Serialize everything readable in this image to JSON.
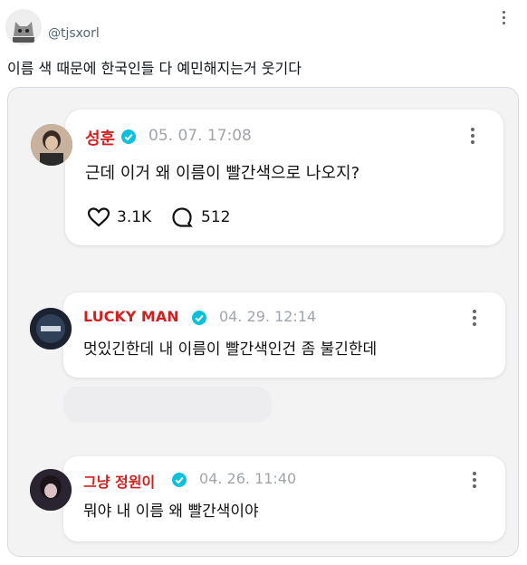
{
  "post": {
    "handle": "@tjsxorl",
    "text": "이름 색 때문에 한국인들 다 예민해지는거 웃기다",
    "avatar_icon": "cat-avatar-icon",
    "more_icon": "more-options-icon"
  },
  "colors": {
    "username_red": "#d31f1f",
    "verified_teal": "#0bc1d9",
    "date_gray": "#a0a5aa",
    "media_bg": "#f3f3f4"
  },
  "comments": [
    {
      "username": "성훈",
      "date": "05. 07. 17:08",
      "text": "근데 이거 왜 이름이 빨간색으로 나오지?",
      "likes": "3.1K",
      "replies": "512"
    },
    {
      "username": "LUCKY MAN",
      "date": "04. 29. 12:14",
      "text": "멋있긴한데 내 이름이 빨간색인건 좀 불긴한데"
    },
    {
      "username": "그냥 정원이",
      "date": "04. 26. 11:40",
      "text": "뭐야 내 이름 왜 빨간색이야"
    }
  ]
}
